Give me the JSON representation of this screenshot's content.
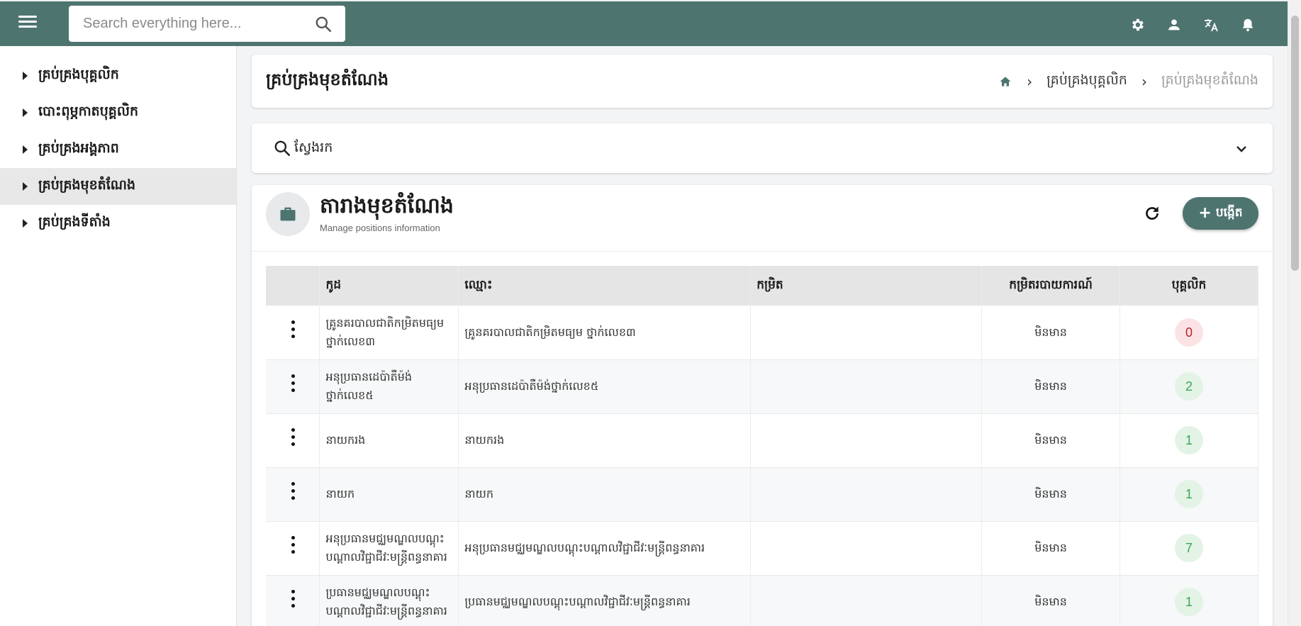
{
  "topbar": {
    "search_placeholder": "Search everything here...",
    "icons": [
      "menu-icon",
      "search-icon",
      "gear-icon",
      "user-icon",
      "translate-icon",
      "bell-icon"
    ],
    "color": "#4e7470"
  },
  "sidebar": {
    "items": [
      {
        "label": "គ្រប់គ្រងបុគ្គលិក",
        "active": false
      },
      {
        "label": "បោះពុម្ភកាតបុគ្គលិក",
        "active": false
      },
      {
        "label": "គ្រប់គ្រងអង្គភាព",
        "active": false
      },
      {
        "label": "គ្រប់គ្រងមុខតំណែង",
        "active": true
      },
      {
        "label": "គ្រប់គ្រងទីតាំង",
        "active": false
      }
    ]
  },
  "header": {
    "title": "គ្រប់គ្រងមុខតំណែង",
    "breadcrumb": [
      "គ្រប់គ្រងបុគ្គលិក",
      "គ្រប់គ្រងមុខតំណែង"
    ]
  },
  "search_panel": {
    "label": "ស្វែងរក"
  },
  "table_card": {
    "title": "តារាងមុខតំណែង",
    "subtitle": "Manage positions information",
    "create_label": "បង្កើត",
    "columns": [
      "កូដ",
      "ឈ្មោះ",
      "កម្រិត",
      "កម្រិតរបាយការណ៍",
      "បុគ្គលិក"
    ],
    "rows": [
      {
        "code": "គ្រូនគរបាលជាតិកម្រិតមធ្យម ថ្នាក់លេខ៣",
        "name": "គ្រូនគរបាលជាតិកម្រិតមធ្យម ថ្នាក់លេខ៣",
        "level": "",
        "report_level": "មិនមាន",
        "staff": "0"
      },
      {
        "code": "អនុប្រធានដេប៉ាតឺម៉ង់ ថ្នាក់លេខ៥",
        "name": "អនុប្រធានដេប៉ាតឺម៉ង់ថ្នាក់លេខ៥",
        "level": "",
        "report_level": "មិនមាន",
        "staff": "2"
      },
      {
        "code": "នាយករង",
        "name": "នាយករង",
        "level": "",
        "report_level": "មិនមាន",
        "staff": "1"
      },
      {
        "code": "នាយក",
        "name": "នាយក",
        "level": "",
        "report_level": "មិនមាន",
        "staff": "1"
      },
      {
        "code": "អនុប្រធានមជ្ឈមណ្ឌលបណ្តុះ បណ្តាលវិជ្ជាជីវៈមន្ត្រីពន្ធនាគារ",
        "name": "អនុប្រធានមជ្ឈមណ្ឌលបណ្តុះបណ្តាលវិជ្ជាជីវៈមន្ត្រីពន្ធនាគារ",
        "level": "",
        "report_level": "មិនមាន",
        "staff": "7"
      },
      {
        "code": "ប្រធានមជ្ឈមណ្ឌលបណ្តុះ បណ្តាលវិជ្ជាជីវៈមន្ត្រីពន្ធនាគារ",
        "name": "ប្រធានមជ្ឈមណ្ឌលបណ្តុះបណ្តាលវិជ្ជាជីវៈមន្ត្រីពន្ធនាគារ",
        "level": "",
        "report_level": "មិនមាន",
        "staff": "1"
      }
    ]
  }
}
